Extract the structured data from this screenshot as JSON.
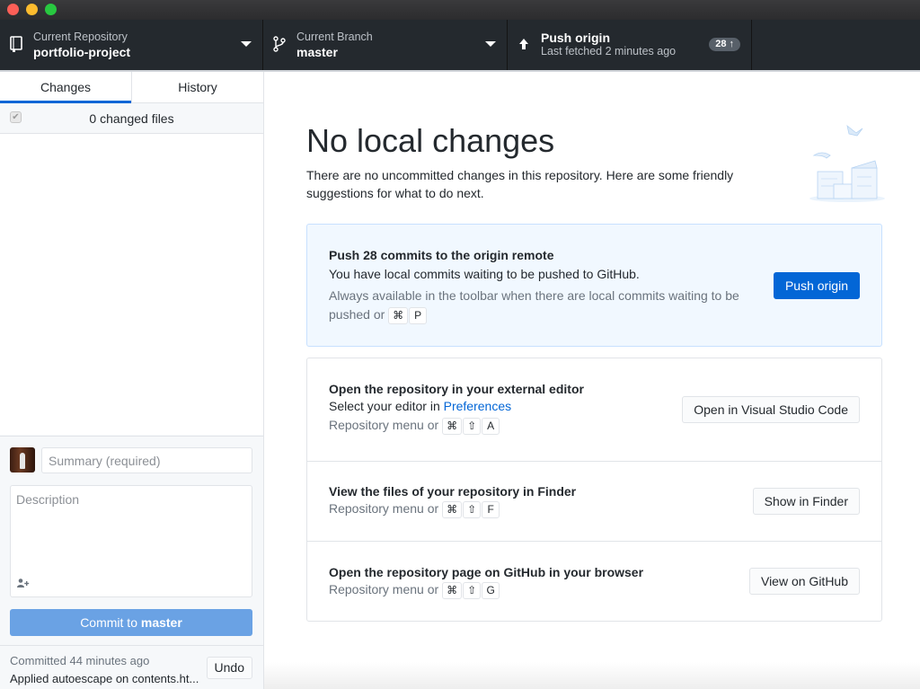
{
  "window": {
    "controls": [
      "close",
      "minimize",
      "maximize"
    ]
  },
  "toolbar": {
    "repository": {
      "label": "Current Repository",
      "value": "portfolio-project",
      "icon": "repo-icon"
    },
    "branch": {
      "label": "Current Branch",
      "value": "master",
      "icon": "git-branch-icon"
    },
    "push": {
      "title": "Push origin",
      "subtitle": "Last fetched 2 minutes ago",
      "icon": "arrow-up-icon",
      "badge": "28 ↑"
    }
  },
  "sidebar": {
    "tabs": [
      {
        "label": "Changes",
        "active": true
      },
      {
        "label": "History",
        "active": false
      }
    ],
    "changed_files_label": "0 changed files",
    "select_all_checked": true,
    "commit": {
      "summary_placeholder": "Summary (required)",
      "summary_value": "",
      "description_placeholder": "Description",
      "description_value": "",
      "coauthor_icon": "♂+",
      "button_prefix": "Commit to ",
      "button_branch": "master"
    },
    "last_commit": {
      "time": "Committed 44 minutes ago",
      "message": "Applied autoescape on contents.ht...",
      "undo_label": "Undo"
    }
  },
  "main": {
    "heading": "No local changes",
    "intro": "There are no uncommitted changes in this repository. Here are some friendly suggestions for what to do next.",
    "push_card": {
      "title": "Push 28 commits to the origin remote",
      "description": "You have local commits waiting to be pushed to GitHub.",
      "hint": "Always available in the toolbar when there are local commits waiting to be pushed or",
      "shortcut": [
        "⌘",
        "P"
      ],
      "button": "Push origin"
    },
    "actions": [
      {
        "title": "Open the repository in your external editor",
        "description_prefix": "Select your editor in ",
        "description_link": "Preferences",
        "hint": "Repository menu or",
        "shortcut": [
          "⌘",
          "⇧",
          "A"
        ],
        "button": "Open in Visual Studio Code"
      },
      {
        "title": "View the files of your repository in Finder",
        "hint": "Repository menu or",
        "shortcut": [
          "⌘",
          "⇧",
          "F"
        ],
        "button": "Show in Finder"
      },
      {
        "title": "Open the repository page on GitHub in your browser",
        "hint": "Repository menu or",
        "shortcut": [
          "⌘",
          "⇧",
          "G"
        ],
        "button": "View on GitHub"
      }
    ]
  },
  "colors": {
    "accent": "#0366d6",
    "toolbar_bg": "#24292e",
    "commit_button": "#6aa2e4",
    "push_card_bg": "#f1f8ff"
  }
}
